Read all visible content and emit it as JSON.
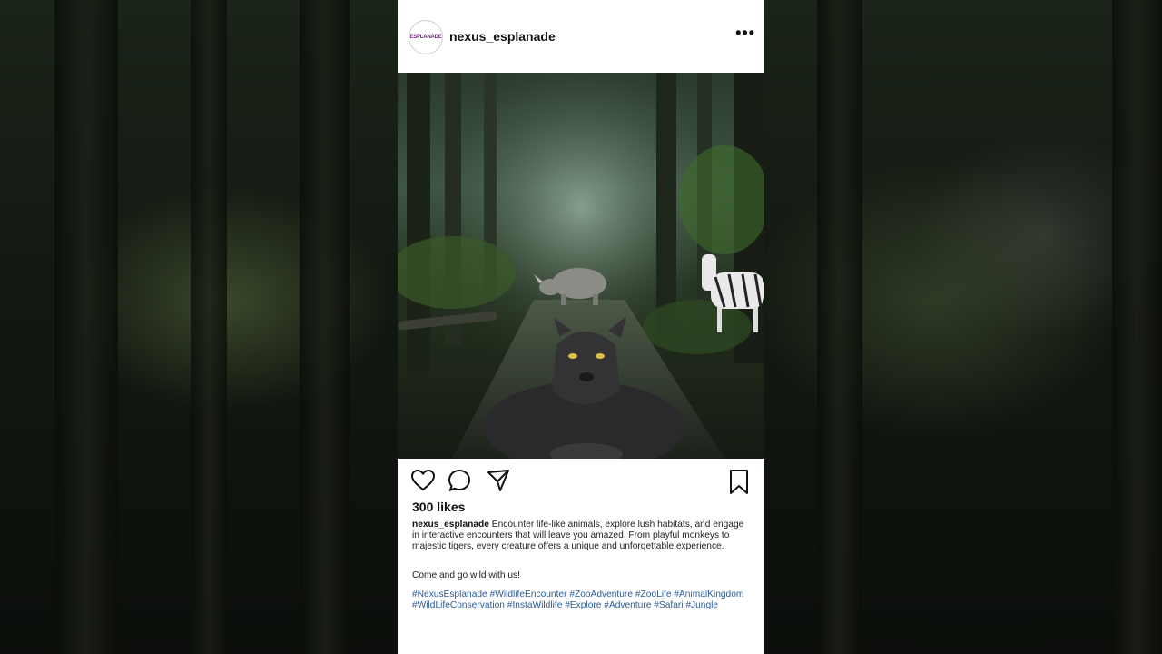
{
  "post": {
    "username": "nexus_esplanade",
    "avatar_text": "ESPLANADE",
    "more_label": "•••",
    "likes": "300 likes",
    "caption_user": "nexus_esplanade",
    "caption_text": "Encounter life-like animals, explore lush habitats, and engage in interactive encounters that will leave you amazed. From playful monkeys to majestic tigers, every creature offers a unique and unforgettable experience.",
    "cta": "Come and go wild with us!",
    "hashtags": [
      "#NexusEsplanade",
      "#WildlifeEncounter",
      "#ZooAdventure",
      "#ZooLife",
      "#AnimalKingdom",
      "#WildLifeConservation",
      "#InstaWildlife",
      "#Explore",
      "#Adventure",
      "#Safari",
      "#Jungle"
    ]
  },
  "icons": {
    "like": "heart-icon",
    "comment": "comment-icon",
    "share": "share-icon",
    "save": "bookmark-icon",
    "more": "more-options-icon"
  },
  "colors": {
    "hashtag": "#2b5c94",
    "avatar_accent": "#7a2a8a"
  }
}
